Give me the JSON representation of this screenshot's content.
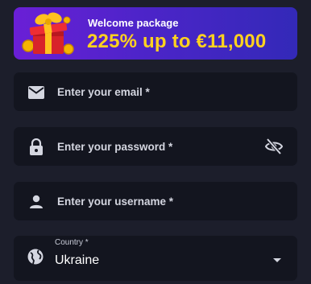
{
  "banner": {
    "title": "Welcome package",
    "offer": "225% up to €11,000",
    "icon": "gift-box-icon",
    "accent_color": "#ffd21f"
  },
  "form": {
    "email": {
      "placeholder": "Enter your email *",
      "value": "",
      "icon": "email-icon"
    },
    "password": {
      "placeholder": "Enter your password *",
      "value": "",
      "icon": "lock-icon",
      "toggle_icon": "eye-off-icon"
    },
    "username": {
      "placeholder": "Enter your username *",
      "value": "",
      "icon": "person-icon"
    },
    "country": {
      "label": "Country *",
      "value": "Ukraine",
      "icon": "globe-icon",
      "dropdown_icon": "chevron-down-icon"
    }
  }
}
